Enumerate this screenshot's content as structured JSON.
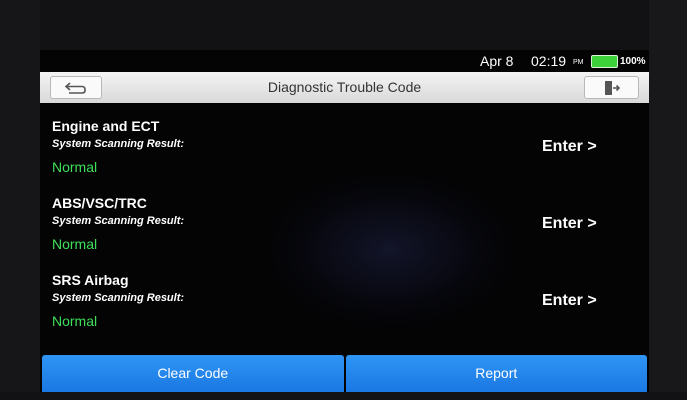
{
  "status_bar": {
    "date": "Apr 8",
    "time": "02:19",
    "ampm": "PM",
    "battery": "100%"
  },
  "header": {
    "title": "Diagnostic Trouble Code"
  },
  "systems": [
    {
      "name": "Engine and ECT",
      "subtitle": "System Scanning Result:",
      "status": "Normal",
      "action": "Enter >"
    },
    {
      "name": "ABS/VSC/TRC",
      "subtitle": "System Scanning Result:",
      "status": "Normal",
      "action": "Enter >"
    },
    {
      "name": "SRS Airbag",
      "subtitle": "System Scanning Result:",
      "status": "Normal",
      "action": "Enter >"
    }
  ],
  "footer": {
    "clear_label": "Clear Code",
    "report_label": "Report"
  },
  "colors": {
    "accent": "#2288ee",
    "normal": "#3ee05a",
    "battery": "#3ed23a"
  }
}
